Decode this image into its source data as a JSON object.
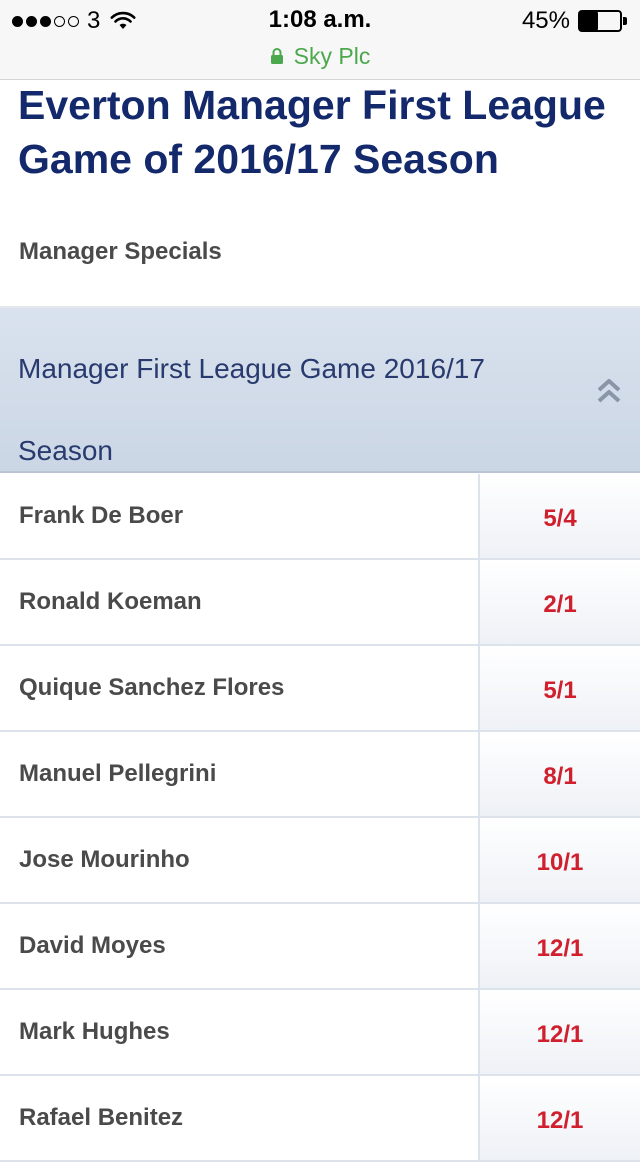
{
  "status_bar": {
    "carrier": "3",
    "time": "1:08 a.m.",
    "battery_percent": "45%",
    "battery_level": 0.45,
    "signal_bars_filled": 3,
    "signal_bars_total": 5,
    "site": "Sky Plc"
  },
  "market": {
    "title": "Everton Manager First League Game of 2016/17 Season",
    "subtitle": "Manager Specials"
  },
  "section": {
    "title": "Manager First League Game 2016/17 Season"
  },
  "selections": [
    {
      "name": "Frank De Boer",
      "odds": "5/4"
    },
    {
      "name": "Ronald Koeman",
      "odds": "2/1"
    },
    {
      "name": "Quique Sanchez Flores",
      "odds": "5/1"
    },
    {
      "name": "Manuel Pellegrini",
      "odds": "8/1"
    },
    {
      "name": "Jose Mourinho",
      "odds": "10/1"
    },
    {
      "name": "David Moyes",
      "odds": "12/1"
    },
    {
      "name": "Mark Hughes",
      "odds": "12/1"
    },
    {
      "name": "Rafael Benitez",
      "odds": "12/1"
    }
  ],
  "colors": {
    "title": "#13296b",
    "odds": "#d0202e",
    "secure": "#4ca84c",
    "band": "#d9e2ee"
  },
  "icons": [
    "wifi-icon",
    "lock-icon",
    "battery-icon",
    "chevron-double-up-icon"
  ]
}
